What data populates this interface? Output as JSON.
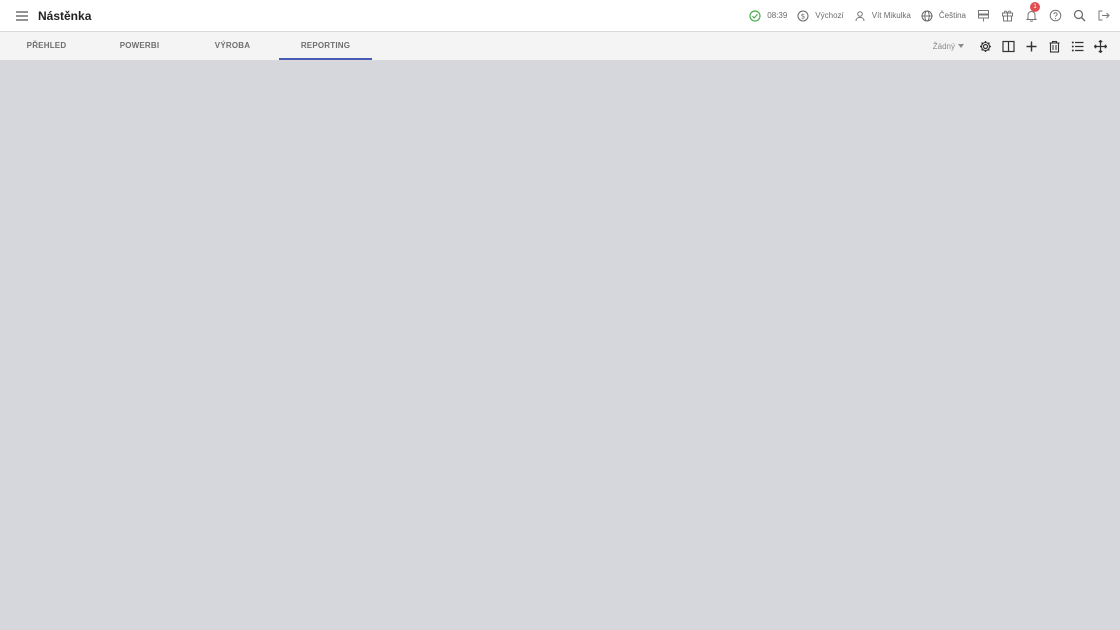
{
  "header": {
    "title": "Nástěnka",
    "menu_icon": "hamburger-menu-icon",
    "status": {
      "icon": "check-circle-icon",
      "time": "08:39",
      "color": "#4caf50"
    },
    "currency": {
      "icon": "dollar-circle-icon",
      "label": "Výchozí"
    },
    "user": {
      "icon": "user-icon",
      "label": "Vít Mikulka"
    },
    "language": {
      "icon": "globe-icon",
      "label": "Čeština"
    },
    "icons": [
      "signpost-icon",
      "gift-icon",
      "bell-icon",
      "help-icon",
      "search-icon",
      "logout-icon"
    ],
    "notification_count": "1",
    "badge_color": "#e24d54"
  },
  "tabs": [
    {
      "label": "PŘEHLED",
      "active": false
    },
    {
      "label": "POWERBI",
      "active": false
    },
    {
      "label": "VÝROBA",
      "active": false
    },
    {
      "label": "REPORTING",
      "active": true
    }
  ],
  "toolbar": {
    "selected_layout": "Žádný",
    "icons": [
      "settings-icon",
      "columns-icon",
      "plus-icon",
      "trash-icon",
      "list-icon",
      "move-icon"
    ]
  },
  "colors": {
    "accent": "#4b5bb5",
    "background": "#d6d7dc"
  }
}
